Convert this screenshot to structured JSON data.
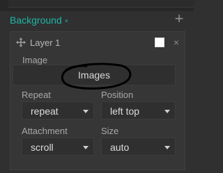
{
  "section": {
    "title": "Background",
    "close_mark": "×",
    "add_mark": "+"
  },
  "layer": {
    "name": "Layer 1",
    "close_mark": "×"
  },
  "image": {
    "label": "Image",
    "button_label": "Images"
  },
  "repeat": {
    "label": "Repeat",
    "value": "repeat"
  },
  "position": {
    "label": "Position",
    "value": "left top"
  },
  "attachment": {
    "label": "Attachment",
    "value": "scroll"
  },
  "size": {
    "label": "Size",
    "value": "auto"
  },
  "colors": {
    "accent": "#1fb6a6",
    "swatch": "#ffffff"
  }
}
